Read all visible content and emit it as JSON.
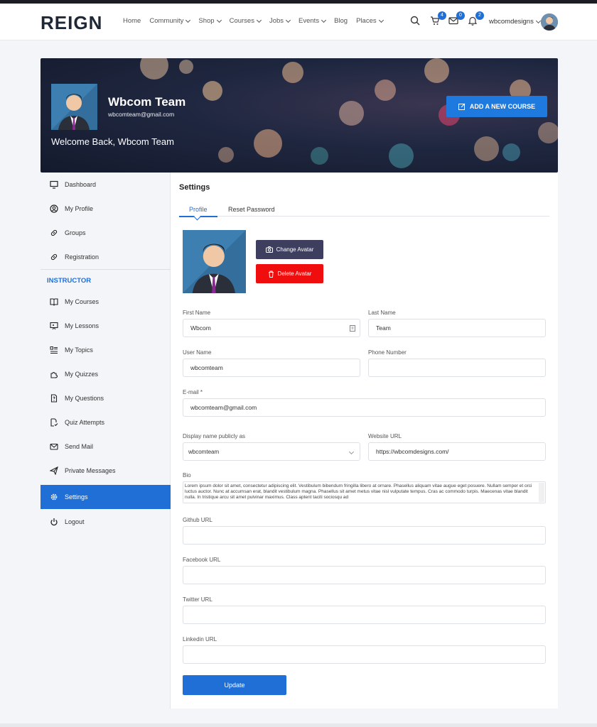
{
  "brand": {
    "logo": "REIGN"
  },
  "nav": {
    "items": [
      {
        "label": "Home",
        "dropdown": false
      },
      {
        "label": "Community",
        "dropdown": true
      },
      {
        "label": "Shop",
        "dropdown": true
      },
      {
        "label": "Courses",
        "dropdown": true
      },
      {
        "label": "Jobs",
        "dropdown": true
      },
      {
        "label": "Events",
        "dropdown": true
      },
      {
        "label": "Blog",
        "dropdown": false
      },
      {
        "label": "Places",
        "dropdown": true
      }
    ]
  },
  "header": {
    "cart_count": "4",
    "messages_count": "0",
    "notifications_count": "2",
    "username": "wbcomdesigns"
  },
  "banner": {
    "name": "Wbcom Team",
    "email": "wbcomteam@gmail.com",
    "welcome": "Welcome Back, Wbcom Team",
    "add_course_label": "ADD A NEW COURSE"
  },
  "sidebar": {
    "items": [
      {
        "label": "Dashboard",
        "icon": "monitor-icon"
      },
      {
        "label": "My Profile",
        "icon": "user-circle-icon"
      },
      {
        "label": "Groups",
        "icon": "link-icon"
      },
      {
        "label": "Registration",
        "icon": "link-icon"
      }
    ],
    "instructor_heading": "INSTRUCTOR",
    "instructor_items": [
      {
        "label": "My Courses",
        "icon": "book-icon"
      },
      {
        "label": "My Lessons",
        "icon": "presentation-icon"
      },
      {
        "label": "My Topics",
        "icon": "list-icon"
      },
      {
        "label": "My Quizzes",
        "icon": "puzzle-icon"
      },
      {
        "label": "My Questions",
        "icon": "question-file-icon"
      },
      {
        "label": "Quiz Attempts",
        "icon": "file-check-icon"
      },
      {
        "label": "Send Mail",
        "icon": "mail-icon"
      },
      {
        "label": "Private Messages",
        "icon": "send-icon"
      },
      {
        "label": "Settings",
        "icon": "gear-icon",
        "active": true
      },
      {
        "label": "Logout",
        "icon": "power-icon"
      }
    ]
  },
  "settings": {
    "title": "Settings",
    "tabs": [
      {
        "label": "Profile",
        "active": true
      },
      {
        "label": "Reset Password",
        "active": false
      }
    ],
    "change_avatar_label": "Change Avatar",
    "delete_avatar_label": "Delete Avatar",
    "fields": {
      "first_name": {
        "label": "First Name",
        "value": "Wbcom"
      },
      "last_name": {
        "label": "Last Name",
        "value": "Team"
      },
      "user_name": {
        "label": "User Name",
        "value": "wbcomteam"
      },
      "phone": {
        "label": "Phone Number",
        "value": ""
      },
      "email": {
        "label": "E-mail *",
        "value": "wbcomteam@gmail.com"
      },
      "display_name": {
        "label": "Display name publicly as",
        "value": "wbcomteam"
      },
      "website": {
        "label": "Website URL",
        "value": "https://wbcomdesigns.com/"
      },
      "bio": {
        "label": "Bio",
        "value": "Lorem ipsum dolor sit amet, consectetur adipiscing elit. Vestibulum bibendum fringilla libero at ornare. Phasellus aliquam vitae augue eget posuere. Nullam semper et orci luctus auctor. Nunc at accumsan erat, blandit vestibulum magna. Phasellus sit amet metus vitae nisl vulputate tempus. Cras ac commodo turpis. Maecenas vitae blandit nulla. In tristique arcu sit amet pulvinar maximus. Class aptent taciti sociosqu ad"
      },
      "github": {
        "label": "Github URL",
        "value": ""
      },
      "facebook": {
        "label": "Facebook URL",
        "value": ""
      },
      "twitter": {
        "label": "Twitter URL",
        "value": ""
      },
      "linkedin": {
        "label": "Linkedin URL",
        "value": ""
      }
    },
    "update_label": "Update"
  },
  "colors": {
    "primary": "#1f6fd6",
    "add_course": "#1f7ae0",
    "change_avatar": "#3e3f5e",
    "delete_avatar": "#ef0d0d",
    "banner_dark": "#1f2740"
  }
}
